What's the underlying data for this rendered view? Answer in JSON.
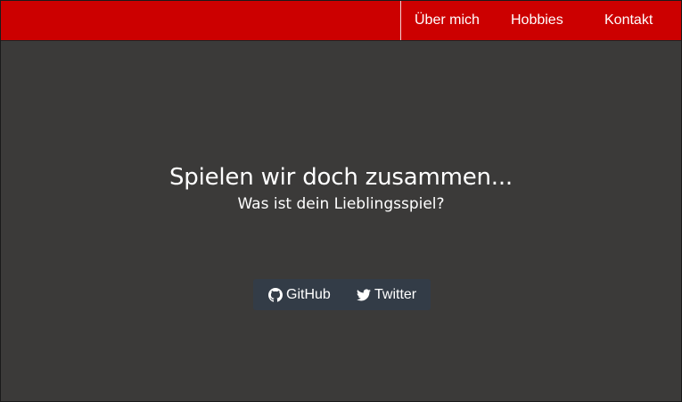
{
  "nav": {
    "items": [
      {
        "label": "Über mich"
      },
      {
        "label": "Hobbies"
      },
      {
        "label": "Kontakt"
      }
    ]
  },
  "hero": {
    "title": "Spielen wir doch zusammen...",
    "subtitle": "Was ist dein Lieblingsspiel?"
  },
  "social": {
    "links": [
      {
        "label": "GitHub",
        "icon": "github-icon"
      },
      {
        "label": "Twitter",
        "icon": "twitter-icon"
      }
    ]
  },
  "colors": {
    "nav_background": "#cc0000",
    "page_background": "#3b3a39",
    "social_bar_background": "#333c47",
    "text": "#ffffff"
  }
}
